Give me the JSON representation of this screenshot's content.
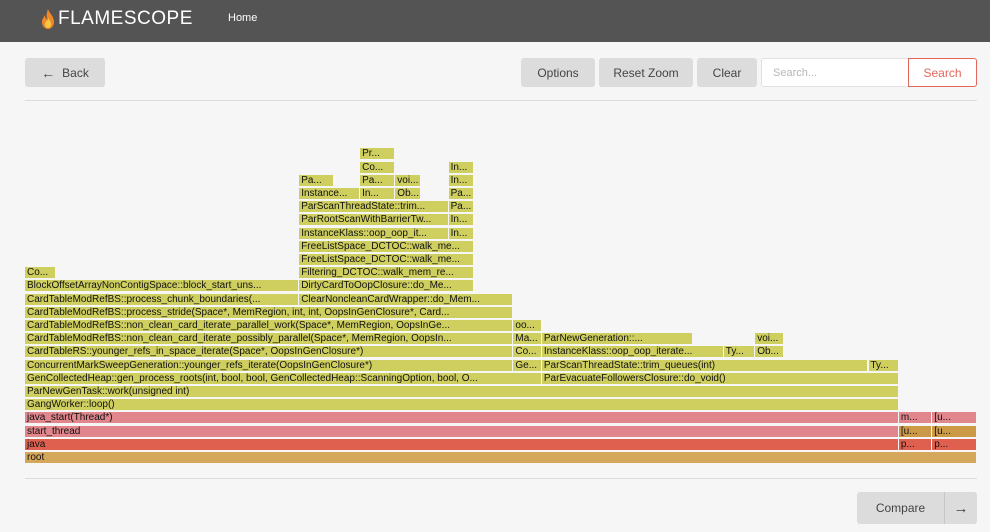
{
  "header": {
    "brand": "FLAMESCOPE",
    "nav_home": "Home"
  },
  "toolbar": {
    "back_label": "Back",
    "options_label": "Options",
    "reset_zoom_label": "Reset Zoom",
    "clear_label": "Clear",
    "search_placeholder": "Search...",
    "search_label": "Search"
  },
  "footer": {
    "compare_label": "Compare"
  },
  "colors": {
    "topbar": "#545454",
    "accent": "#e2665a",
    "yellow": "#cfcf60",
    "orange": "#d5a75a",
    "red_java": "#e06050",
    "pink": "#e0868c",
    "brown": "#cc9a46"
  },
  "flamegraph": {
    "frames": [
      {
        "label": "root",
        "depth": 0,
        "start": 0,
        "end": 100,
        "color": "orange"
      },
      {
        "label": "java",
        "depth": 1,
        "start": 0,
        "end": 91.8,
        "color": "red"
      },
      {
        "label": "p...",
        "depth": 1,
        "start": 91.8,
        "end": 95.3,
        "color": "red"
      },
      {
        "label": "p...",
        "depth": 1,
        "start": 95.3,
        "end": 100,
        "color": "red"
      },
      {
        "label": "start_thread",
        "depth": 2,
        "start": 0,
        "end": 91.8,
        "color": "pink"
      },
      {
        "label": "[u...",
        "depth": 2,
        "start": 91.8,
        "end": 95.3,
        "color": "brown"
      },
      {
        "label": "[u...",
        "depth": 2,
        "start": 95.3,
        "end": 100,
        "color": "brown"
      },
      {
        "label": "java_start(Thread*)",
        "depth": 3,
        "start": 0,
        "end": 91.8,
        "color": "pink"
      },
      {
        "label": "m...",
        "depth": 3,
        "start": 91.8,
        "end": 95.3,
        "color": "pink"
      },
      {
        "label": "[u...",
        "depth": 3,
        "start": 95.3,
        "end": 100,
        "color": "pink"
      },
      {
        "label": "GangWorker::loop()",
        "depth": 4,
        "start": 0,
        "end": 91.8,
        "color": "yellow"
      },
      {
        "label": "ParNewGenTask::work(unsigned int)",
        "depth": 5,
        "start": 0,
        "end": 91.8,
        "color": "yellow"
      },
      {
        "label": "GenCollectedHeap::gen_process_roots(int, bool, bool, GenCollectedHeap::ScanningOption, bool, O...",
        "depth": 6,
        "start": 0,
        "end": 54.3,
        "color": "yellow"
      },
      {
        "label": "ParEvacuateFollowersClosure::do_void()",
        "depth": 6,
        "start": 54.3,
        "end": 91.8,
        "color": "yellow"
      },
      {
        "label": "ConcurrentMarkSweepGeneration::younger_refs_iterate(OopsInGenClosure*)",
        "depth": 7,
        "start": 0,
        "end": 51.3,
        "color": "yellow"
      },
      {
        "label": "Ge...",
        "depth": 7,
        "start": 51.3,
        "end": 54.3,
        "color": "yellow"
      },
      {
        "label": "ParScanThreadState::trim_queues(int)",
        "depth": 7,
        "start": 54.3,
        "end": 88.6,
        "color": "yellow"
      },
      {
        "label": "Ty...",
        "depth": 7,
        "start": 88.6,
        "end": 91.8,
        "color": "yellow"
      },
      {
        "label": "CardTableRS::younger_refs_in_space_iterate(Space*, OopsInGenClosure*)",
        "depth": 8,
        "start": 0,
        "end": 51.3,
        "color": "yellow"
      },
      {
        "label": "Co...",
        "depth": 8,
        "start": 51.3,
        "end": 54.3,
        "color": "yellow"
      },
      {
        "label": "InstanceKlass::oop_oop_iterate...",
        "depth": 8,
        "start": 54.3,
        "end": 73.4,
        "color": "yellow"
      },
      {
        "label": "Ty...",
        "depth": 8,
        "start": 73.4,
        "end": 76.7,
        "color": "yellow"
      },
      {
        "label": "Ob...",
        "depth": 8,
        "start": 76.7,
        "end": 79.7,
        "color": "yellow"
      },
      {
        "label": "CardTableModRefBS::non_clean_card_iterate_possibly_parallel(Space*, MemRegion, OopsIn...",
        "depth": 9,
        "start": 0,
        "end": 51.3,
        "color": "yellow"
      },
      {
        "label": "Ma...",
        "depth": 9,
        "start": 51.3,
        "end": 54.3,
        "color": "yellow"
      },
      {
        "label": "ParNewGeneration::...",
        "depth": 9,
        "start": 54.3,
        "end": 70.2,
        "color": "yellow"
      },
      {
        "label": "voi...",
        "depth": 9,
        "start": 76.7,
        "end": 79.7,
        "color": "yellow"
      },
      {
        "label": "CardTableModRefBS::non_clean_card_iterate_parallel_work(Space*, MemRegion, OopsInGe...",
        "depth": 10,
        "start": 0,
        "end": 51.3,
        "color": "yellow"
      },
      {
        "label": "oo...",
        "depth": 10,
        "start": 51.3,
        "end": 54.3,
        "color": "yellow"
      },
      {
        "label": "CardTableModRefBS::process_stride(Space*, MemRegion, int, int, OopsInGenClosure*, Card...",
        "depth": 11,
        "start": 0,
        "end": 51.3,
        "color": "yellow"
      },
      {
        "label": "CardTableModRefBS::process_chunk_boundaries(...",
        "depth": 12,
        "start": 0,
        "end": 28.8,
        "color": "yellow"
      },
      {
        "label": "ClearNoncleanCardWrapper::do_Mem...",
        "depth": 12,
        "start": 28.8,
        "end": 51.3,
        "color": "yellow"
      },
      {
        "label": "BlockOffsetArrayNonContigSpace::block_start_uns...",
        "depth": 13,
        "start": 0,
        "end": 28.8,
        "color": "yellow"
      },
      {
        "label": "DirtyCardToOopClosure::do_Me...",
        "depth": 13,
        "start": 28.8,
        "end": 47.2,
        "color": "yellow"
      },
      {
        "label": "Co...",
        "depth": 14,
        "start": 0,
        "end": 3.2,
        "color": "yellow"
      },
      {
        "label": "Filtering_DCTOC::walk_mem_re...",
        "depth": 14,
        "start": 28.8,
        "end": 47.2,
        "color": "yellow"
      },
      {
        "label": "FreeListSpace_DCTOC::walk_me...",
        "depth": 15,
        "start": 28.8,
        "end": 47.2,
        "color": "yellow"
      },
      {
        "label": "FreeListSpace_DCTOC::walk_me...",
        "depth": 16,
        "start": 28.8,
        "end": 47.2,
        "color": "yellow"
      },
      {
        "label": "InstanceKlass::oop_oop_it...",
        "depth": 17,
        "start": 28.8,
        "end": 44.5,
        "color": "yellow"
      },
      {
        "label": "In...",
        "depth": 17,
        "start": 44.5,
        "end": 47.2,
        "color": "yellow"
      },
      {
        "label": "ParRootScanWithBarrierTw...",
        "depth": 18,
        "start": 28.8,
        "end": 44.5,
        "color": "yellow"
      },
      {
        "label": "In...",
        "depth": 18,
        "start": 44.5,
        "end": 47.2,
        "color": "yellow"
      },
      {
        "label": "ParScanThreadState::trim...",
        "depth": 19,
        "start": 28.8,
        "end": 44.5,
        "color": "yellow"
      },
      {
        "label": "Pa...",
        "depth": 19,
        "start": 44.5,
        "end": 47.2,
        "color": "yellow"
      },
      {
        "label": "Instance...",
        "depth": 20,
        "start": 28.8,
        "end": 35.2,
        "color": "yellow"
      },
      {
        "label": "In...",
        "depth": 20,
        "start": 35.2,
        "end": 38.9,
        "color": "yellow"
      },
      {
        "label": "Ob...",
        "depth": 20,
        "start": 38.9,
        "end": 41.6,
        "color": "yellow"
      },
      {
        "label": "Pa...",
        "depth": 20,
        "start": 44.5,
        "end": 47.2,
        "color": "yellow"
      },
      {
        "label": "Pa...",
        "depth": 21,
        "start": 28.8,
        "end": 32.5,
        "color": "yellow"
      },
      {
        "label": "Pa...",
        "depth": 21,
        "start": 35.2,
        "end": 38.9,
        "color": "yellow"
      },
      {
        "label": "voi...",
        "depth": 21,
        "start": 38.9,
        "end": 41.6,
        "color": "yellow"
      },
      {
        "label": "In...",
        "depth": 21,
        "start": 44.5,
        "end": 47.2,
        "color": "yellow"
      },
      {
        "label": "Co...",
        "depth": 22,
        "start": 35.2,
        "end": 38.9,
        "color": "yellow"
      },
      {
        "label": "In...",
        "depth": 22,
        "start": 44.5,
        "end": 47.2,
        "color": "yellow"
      },
      {
        "label": "Pr...",
        "depth": 23,
        "start": 35.2,
        "end": 38.9,
        "color": "yellow"
      }
    ]
  }
}
